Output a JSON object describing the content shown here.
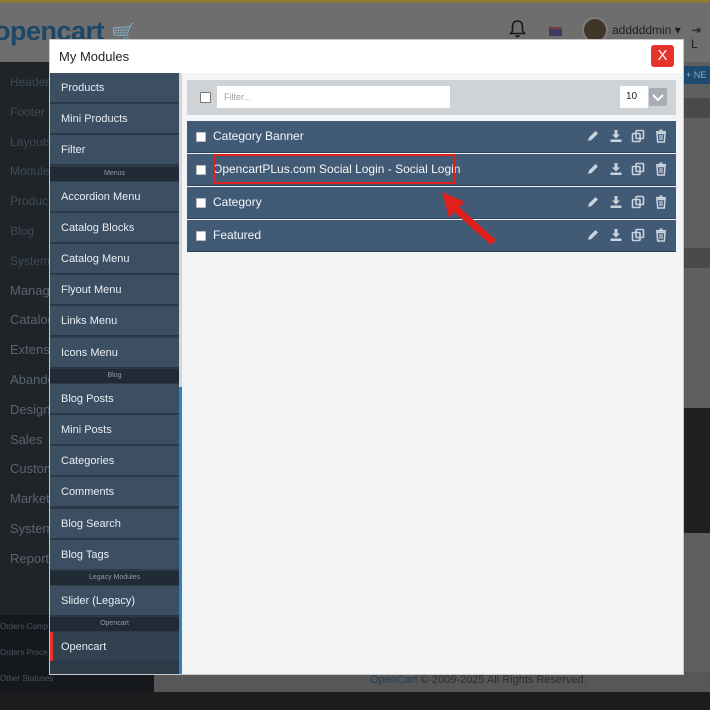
{
  "background": {
    "logo_text": "opencart",
    "user_name": "adddddmin",
    "logout_label": "L",
    "new_button_label": "+ NE",
    "sidebar_items": [
      {
        "label": "Header",
        "big": false
      },
      {
        "label": "Footer",
        "big": false
      },
      {
        "label": "Layouts",
        "big": false
      },
      {
        "label": "Modules",
        "big": false
      },
      {
        "label": "Products",
        "big": false
      },
      {
        "label": "Blog",
        "big": false
      },
      {
        "label": "System",
        "big": false
      },
      {
        "label": "Manage",
        "big": true
      },
      {
        "label": "Catalog",
        "big": true
      },
      {
        "label": "Extensio",
        "big": true
      },
      {
        "label": "Abando",
        "big": true
      },
      {
        "label": "Design",
        "big": true
      },
      {
        "label": "Sales",
        "big": true
      },
      {
        "label": "Custome",
        "big": true
      },
      {
        "label": "Marketi",
        "big": true
      },
      {
        "label": "System",
        "big": true
      },
      {
        "label": "Reports",
        "big": true
      }
    ],
    "orders_labels": [
      "Orders Comp",
      "Orders Proce",
      "Other Statuses"
    ],
    "footer_brand": "OpenCart",
    "footer_text": " © 2009-2025 All Rights Reserved."
  },
  "modal": {
    "title": "My Modules",
    "close_label": "X",
    "sidebar": [
      {
        "type": "item",
        "label": "Products"
      },
      {
        "type": "item",
        "label": "Mini Products"
      },
      {
        "type": "item",
        "label": "Filter"
      },
      {
        "type": "group",
        "label": "Menus"
      },
      {
        "type": "item",
        "label": "Accordion Menu"
      },
      {
        "type": "item",
        "label": "Catalog Blocks"
      },
      {
        "type": "item",
        "label": "Catalog Menu"
      },
      {
        "type": "item",
        "label": "Flyout Menu"
      },
      {
        "type": "item",
        "label": "Links Menu"
      },
      {
        "type": "item",
        "label": "Icons Menu"
      },
      {
        "type": "group",
        "label": "Blog"
      },
      {
        "type": "item",
        "label": "Blog Posts"
      },
      {
        "type": "item",
        "label": "Mini Posts"
      },
      {
        "type": "item",
        "label": "Categories"
      },
      {
        "type": "item",
        "label": "Comments"
      },
      {
        "type": "item",
        "label": "Blog Search"
      },
      {
        "type": "item",
        "label": "Blog Tags"
      },
      {
        "type": "group",
        "label": "Legacy Modules"
      },
      {
        "type": "item",
        "label": "Slider (Legacy)"
      },
      {
        "type": "group",
        "label": "Opencart"
      },
      {
        "type": "item",
        "label": "Opencart",
        "active": true
      }
    ],
    "filter_placeholder": "Filter...",
    "per_page": "10",
    "modules": [
      {
        "name": "Category Banner"
      },
      {
        "name": "OpencartPLus.com Social Login - Social Login",
        "highlighted": true
      },
      {
        "name": "Category"
      },
      {
        "name": "Featured"
      }
    ],
    "row_action_icons": [
      "pencil-icon",
      "download-icon",
      "copy-icon",
      "trash-icon"
    ]
  },
  "colors": {
    "close_button": "#e5342b",
    "row_background": "#415a76",
    "sidebar_item": "#3b4e62",
    "highlight": "#e0201a"
  }
}
